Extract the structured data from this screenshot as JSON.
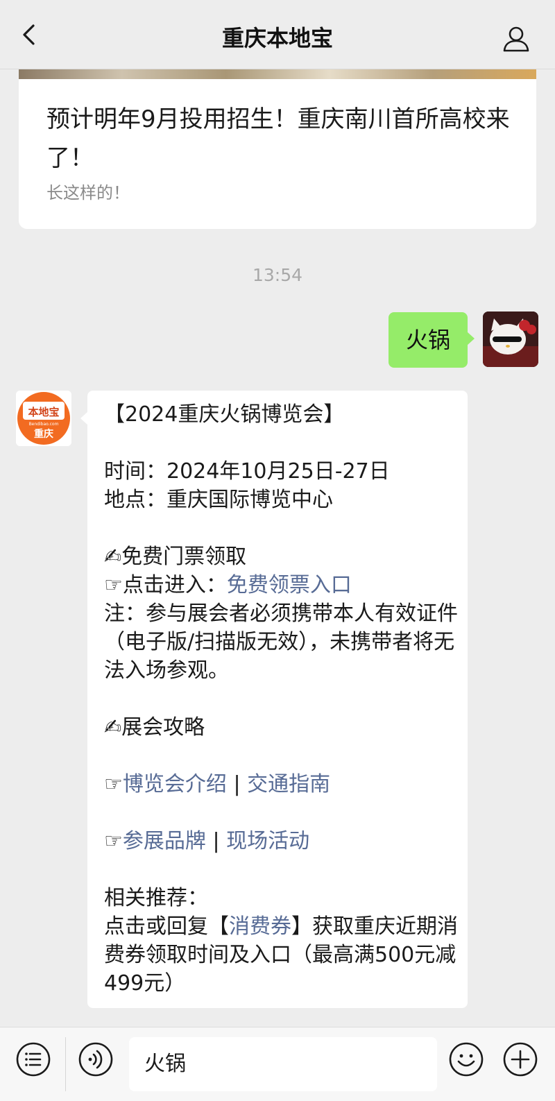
{
  "nav": {
    "title": "重庆本地宝"
  },
  "article": {
    "headline": "预计明年9月投用招生！重庆南川首所高校来了！",
    "summary": "长这样的！"
  },
  "timestamp": "13:54",
  "outgoing": {
    "text": "火锅"
  },
  "bot_avatar": {
    "logo_text": "本地宝",
    "url_text": "Bendibao.com",
    "city": "重庆"
  },
  "reply": {
    "title": "【2024重庆火锅博览会】",
    "time_line": "时间：2024年10月25日-27日",
    "place_line": "地点：重庆国际博览中心",
    "ticket_heading": "✍免费门票领取",
    "ticket_prefix": "☞点击进入：",
    "ticket_link": "免费领票入口",
    "note": "注：参与展会者必须携带本人有效证件（电子版/扫描版无效），未携带者将无法入场参观。",
    "guide_heading": "✍展会攻略",
    "pointer": "☞",
    "separator": " | ",
    "links_row1": [
      "博览会介绍",
      "交通指南"
    ],
    "links_row2": [
      "参展品牌",
      "现场活动"
    ],
    "related_label": "相关推荐：",
    "related_prefix": "点击或回复【",
    "related_link": "消费券",
    "related_suffix": "】获取重庆近期消费券领取时间及入口（最高满500元减499元）"
  },
  "input": {
    "value": "火锅"
  },
  "icons": [
    "back-icon",
    "profile-icon",
    "menu-list-icon",
    "voice-icon",
    "emoji-icon",
    "plus-icon"
  ],
  "colors": {
    "bubble_out": "#95ec69",
    "link": "#576b95",
    "brand_orange": "#f26b21",
    "background": "#ededed"
  }
}
